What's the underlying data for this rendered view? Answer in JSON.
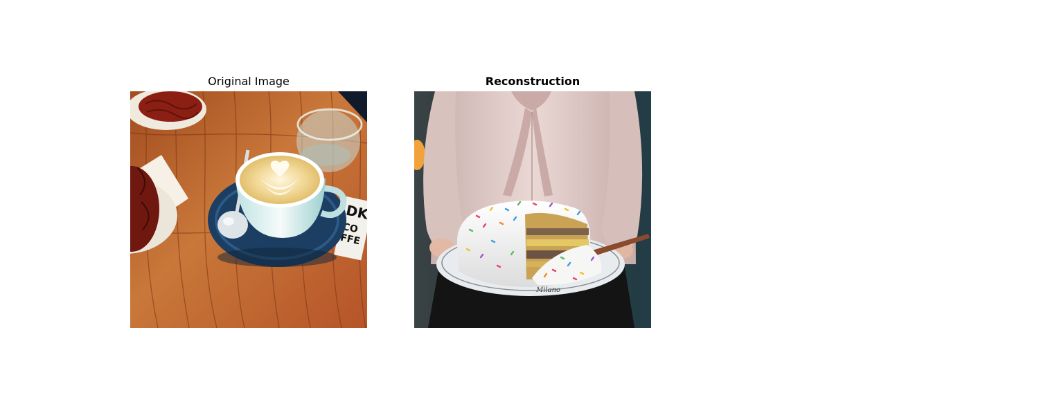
{
  "figure": {
    "panels": [
      {
        "title": "Original Image",
        "title_bold": false,
        "image": {
          "subject": "latte art coffee cup on blue saucer on wooden table with pastries and water glass",
          "visible_text": "DK COFFEE"
        }
      },
      {
        "title": "Reconstruction",
        "title_bold": true,
        "image": {
          "subject": "person in pink blouse holding a white frosted sprinkle cake with a slice cut out on a plate",
          "visible_text": "Milano"
        }
      }
    ]
  },
  "colors": {
    "background": "#ffffff",
    "wood": "#b8622a",
    "saucer": "#1c3e63",
    "blouse": "#e2cdca",
    "frosting": "#f4f2ef",
    "skirt": "#141414"
  }
}
